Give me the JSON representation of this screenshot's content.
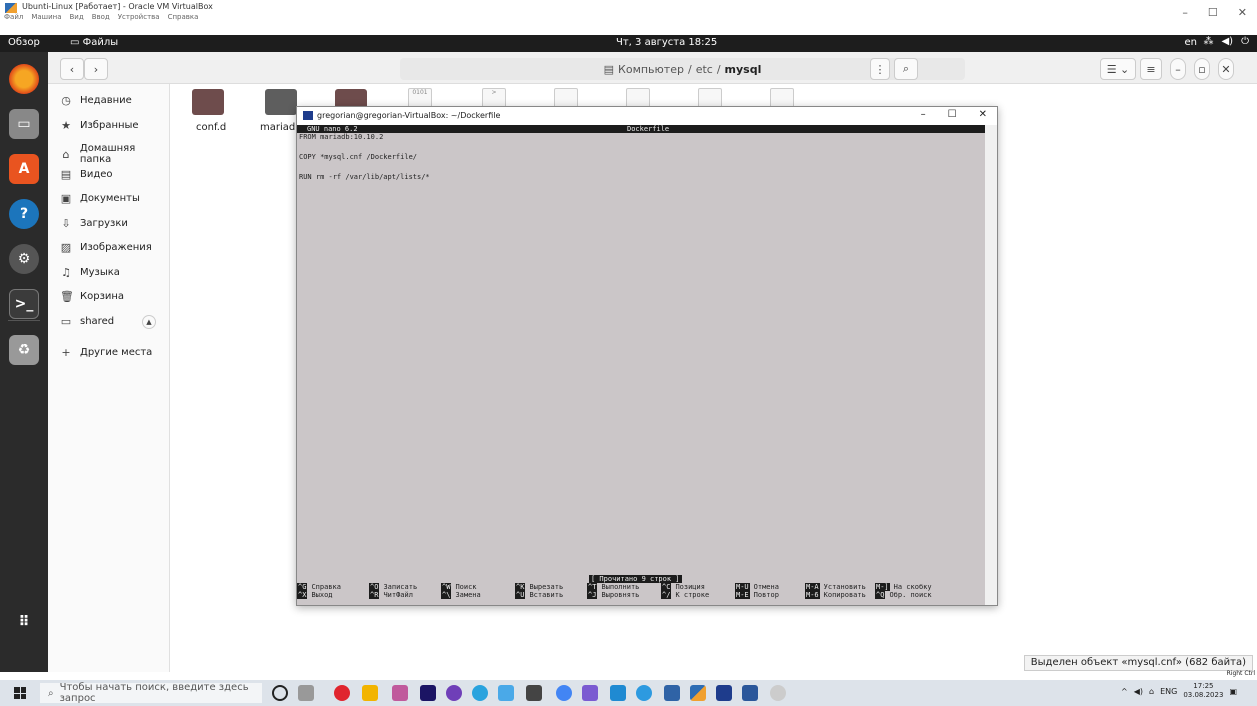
{
  "vbox": {
    "title": "Ubunti-Linux [Работает] - Oracle VM VirtualBox",
    "menu": [
      "Файл",
      "Машина",
      "Вид",
      "Ввод",
      "Устройства",
      "Справка"
    ],
    "ctrl_min": "–",
    "ctrl_max": "☐",
    "ctrl_close": "✕"
  },
  "topbar": {
    "overview": "Обзор",
    "app": "Файлы",
    "datetime": "Чт, 3 августа 18:25",
    "lang": "en"
  },
  "files": {
    "path_root": "Компьютер",
    "path_mid": "etc",
    "path_leaf": "mysql",
    "sep": "/",
    "sidebar": [
      {
        "icon": "◷",
        "label": "Недавние"
      },
      {
        "icon": "★",
        "label": "Избранные"
      },
      {
        "icon": "⌂",
        "label": "Домашняя папка"
      },
      {
        "icon": "▤",
        "label": "Видео"
      },
      {
        "icon": "▣",
        "label": "Документы"
      },
      {
        "icon": "⇩",
        "label": "Загрузки"
      },
      {
        "icon": "▨",
        "label": "Изображения"
      },
      {
        "icon": "♫",
        "label": "Музыка"
      },
      {
        "icon": "🗑",
        "label": "Корзина"
      },
      {
        "icon": "▭",
        "label": "shared"
      },
      {
        "icon": "+",
        "label": "Другие места"
      }
    ],
    "items": [
      "conf.d",
      "mariadb.conf.d"
    ],
    "status": "Выделен объект «mysql.cnf» (682 байта)"
  },
  "terminal": {
    "title": "gregorian@gregorian-VirtualBox: ~/Dockerfile",
    "nano_version": "GNU nano 6.2",
    "nano_file": "Dockerfile",
    "lines": [
      "FROM mariadb:10.10.2",
      "COPY *mysql.cnf /Dockerfile/",
      "RUN rm -rf /var/lib/apt/lists/*"
    ],
    "message": "[ Прочитано 9 строк ]",
    "shortcuts_row1": [
      {
        "k": "^G",
        "l": "Справка"
      },
      {
        "k": "^O",
        "l": "Записать"
      },
      {
        "k": "^W",
        "l": "Поиск"
      },
      {
        "k": "^K",
        "l": "Вырезать"
      },
      {
        "k": "^T",
        "l": "Выполнить"
      },
      {
        "k": "^C",
        "l": "Позиция"
      },
      {
        "k": "M-U",
        "l": "Отмена"
      },
      {
        "k": "M-A",
        "l": "Установить"
      },
      {
        "k": "M-]",
        "l": "На скобку"
      }
    ],
    "shortcuts_row2": [
      {
        "k": "^X",
        "l": "Выход"
      },
      {
        "k": "^R",
        "l": "ЧитФайл"
      },
      {
        "k": "^\\",
        "l": "Замена"
      },
      {
        "k": "^U",
        "l": "Вставить"
      },
      {
        "k": "^J",
        "l": "Выровнять"
      },
      {
        "k": "^/",
        "l": "К строке"
      },
      {
        "k": "M-E",
        "l": "Повтор"
      },
      {
        "k": "M-6",
        "l": "Копировать"
      },
      {
        "k": "^Q",
        "l": "Обр. поиск"
      }
    ]
  },
  "taskbar": {
    "search_placeholder": "Чтобы начать поиск, введите здесь запрос",
    "lang": "ENG",
    "time": "17:25",
    "date": "03.08.2023",
    "hostkey": "Right Ctrl"
  }
}
